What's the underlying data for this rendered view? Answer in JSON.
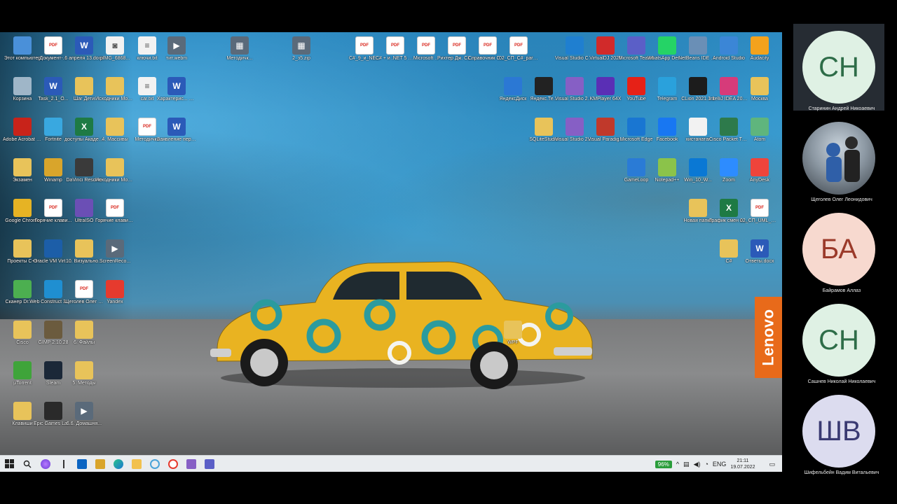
{
  "colors": {
    "pdf_red": "#d9261c",
    "word_blue": "#2b5ab8",
    "excel_green": "#1e7a44",
    "folder_yellow": "#e8c35a",
    "lenovo_orange": "#e86a1a",
    "battery_green": "#2a9d3b",
    "avatar_green_bg": "#dff1e4",
    "avatar_green_fg": "#2e6d48",
    "avatar_pink_bg": "#f7d9cf",
    "avatar_pink_fg": "#9b3a2a",
    "avatar_purple_bg": "#dcdcef",
    "avatar_purple_fg": "#3a3a72"
  },
  "wallpaper": {
    "brand": "Lenovo"
  },
  "desktop_icons": [
    {
      "label": "Этот компьютер",
      "icon": "computer-icon"
    },
    {
      "label": "Документ-...",
      "icon": "pdf-icon"
    },
    {
      "label": "6 апреля 13.docx",
      "icon": "word-icon"
    },
    {
      "label": "pIMG_6868...",
      "icon": "photo-icon"
    },
    {
      "label": "ключи.txt",
      "icon": "text-file-icon"
    },
    {
      "label": "тит.webm",
      "icon": "video-icon"
    },
    {
      "label": "Методичк...",
      "icon": "archive-icon"
    },
    {
      "label": "2_з5.zip",
      "icon": "archive-icon"
    },
    {
      "label": "C#_9_и_NE...",
      "icon": "pdf-icon"
    },
    {
      "label": "C# + и .NET 5 Разработ...",
      "icon": "pdf-icon"
    },
    {
      "label": "Microsoft ...",
      "icon": "pdf-icon"
    },
    {
      "label": "Рихтер Дж. CLR via C#...",
      "icon": "pdf-icon"
    },
    {
      "label": "Справочник C# Кудряв...",
      "icon": "pdf-icon"
    },
    {
      "label": "02_СП_C#_part1.pdf",
      "icon": "pdf-icon"
    },
    {
      "label": "Visual Studio Code",
      "icon": "vscode-icon"
    },
    {
      "label": "VirtualDJ 2021",
      "icon": "virtualdj-icon"
    },
    {
      "label": "Microsoft Teams",
      "icon": "teams-icon"
    },
    {
      "label": "WhatsApp Desktop",
      "icon": "whatsapp-icon"
    },
    {
      "label": "NetBeans IDE 8.2",
      "icon": "netbeans-icon"
    },
    {
      "label": "Android Studio",
      "icon": "android-studio-icon"
    },
    {
      "label": "Audacity",
      "icon": "audacity-icon"
    },
    {
      "label": "Корзина",
      "icon": "recycle-bin-icon"
    },
    {
      "label": "Task_2.1_O...",
      "icon": "word-icon"
    },
    {
      "label": "Шаг Дети",
      "icon": "folder-icon"
    },
    {
      "label": "Исходники Модуль 10",
      "icon": "folder-icon"
    },
    {
      "label": "car.txt",
      "icon": "text-file-icon"
    },
    {
      "label": "Характерис... Захаткин...",
      "icon": "word-icon"
    },
    {
      "label": "ЯндексДиск",
      "icon": "yandex-disk-icon"
    },
    {
      "label": "Яндекс.Те...",
      "icon": "yandex-telemost-icon"
    },
    {
      "label": "Visual Studio 2022",
      "icon": "visual-studio-icon"
    },
    {
      "label": "KMPlayer 64X",
      "icon": "kmplayer-icon"
    },
    {
      "label": "YouTube",
      "icon": "youtube-icon"
    },
    {
      "label": "Telegram",
      "icon": "telegram-icon"
    },
    {
      "label": "CLion 2021.1.1",
      "icon": "clion-icon"
    },
    {
      "label": "IntelliJ IDEA 2020.3 x64",
      "icon": "intellij-icon"
    },
    {
      "label": "Москва",
      "icon": "folder-icon"
    },
    {
      "label": "Adobe Acrobat DC",
      "icon": "acrobat-icon"
    },
    {
      "label": "Fortnite",
      "icon": "fortnite-icon"
    },
    {
      "label": "доступы Академия ...",
      "icon": "excel-icon"
    },
    {
      "label": "4. Массивы",
      "icon": "folder-icon"
    },
    {
      "label": "Методички",
      "icon": "pdf-icon"
    },
    {
      "label": "Заявление периодиче...",
      "icon": "word-icon"
    },
    {
      "label": "SQLiteStudio",
      "icon": "folder-icon"
    },
    {
      "label": "Visual Studio 2017",
      "icon": "visual-studio-icon"
    },
    {
      "label": "Visual Paradig...",
      "icon": "visual-paradigm-icon"
    },
    {
      "label": "Microsoft Edge",
      "icon": "edge-icon"
    },
    {
      "label": "Facebook",
      "icon": "facebook-icon"
    },
    {
      "label": "хистанатаг",
      "icon": "file-icon"
    },
    {
      "label": "Cisco Packet Tracer",
      "icon": "cisco-packet-tracer-icon"
    },
    {
      "label": "Atom",
      "icon": "atom-icon"
    },
    {
      "label": "Экзамен",
      "icon": "folder-icon"
    },
    {
      "label": "Winamp",
      "icon": "winamp-icon"
    },
    {
      "label": "DaVinci Resolve",
      "icon": "davinci-icon"
    },
    {
      "label": "Исходники Модуль 6",
      "icon": "folder-icon"
    },
    {
      "label": "GameLoop",
      "icon": "gameloop-icon"
    },
    {
      "label": "Notepad++",
      "icon": "notepadpp-icon"
    },
    {
      "label": "Win_10_W...",
      "icon": "windows-icon"
    },
    {
      "label": "Zoom",
      "icon": "zoom-icon"
    },
    {
      "label": "AnyDesk",
      "icon": "anydesk-icon"
    },
    {
      "label": "Google Chrome",
      "icon": "chrome-icon"
    },
    {
      "label": "Горячие клави...",
      "icon": "pdf-icon"
    },
    {
      "label": "UltraISO",
      "icon": "ultraiso-icon"
    },
    {
      "label": "Горячие клавиш...",
      "icon": "pdf-icon"
    },
    {
      "label": "Новая папка",
      "icon": "folder-icon"
    },
    {
      "label": "График смен 2022.xlsx",
      "icon": "excel-icon"
    },
    {
      "label": "02_СП_UML_ОР_4...",
      "icon": "pdf-icon"
    },
    {
      "label": "Проекты C++",
      "icon": "folder-icon"
    },
    {
      "label": "Oracle VM VirtualBox",
      "icon": "virtualbox-icon"
    },
    {
      "label": "10. Визуально...",
      "icon": "folder-icon"
    },
    {
      "label": "ScreenReco...",
      "icon": "video-icon"
    },
    {
      "label": "C#",
      "icon": "folder-icon"
    },
    {
      "label": "Ответы.docx",
      "icon": "word-icon"
    },
    {
      "label": "Сканер Dr.Web",
      "icon": "drweb-icon"
    },
    {
      "label": "Construct 3",
      "icon": "construct-icon"
    },
    {
      "label": "Щеголев Олег Леони...",
      "icon": "pdf-icon"
    },
    {
      "label": "Yandex",
      "icon": "yandex-browser-icon"
    },
    {
      "label": "Cisco",
      "icon": "folder-icon"
    },
    {
      "label": "GIMP 2.10.28",
      "icon": "gimp-icon"
    },
    {
      "label": "6. Файлы",
      "icon": "folder-icon"
    },
    {
      "label": "WPF",
      "icon": "folder-icon"
    },
    {
      "label": "µTorrent",
      "icon": "utorrent-icon"
    },
    {
      "label": "Steam",
      "icon": "steam-icon"
    },
    {
      "label": "5. Методы",
      "icon": "folder-icon"
    },
    {
      "label": "Клавиши",
      "icon": "folder-icon"
    },
    {
      "label": "Epic Games Launcher",
      "icon": "epic-games-icon"
    },
    {
      "label": "6.6. Домашня...",
      "icon": "video-icon"
    }
  ],
  "taskbar": {
    "items": [
      {
        "icon": "windows-start-icon"
      },
      {
        "icon": "search-icon"
      },
      {
        "icon": "alice-assistant-icon"
      },
      {
        "icon": "taskview-icon"
      },
      {
        "icon": "outlook-icon"
      },
      {
        "icon": "winamp-icon"
      },
      {
        "icon": "edge-icon"
      },
      {
        "icon": "file-explorer-icon"
      },
      {
        "icon": "refresh-icon"
      },
      {
        "icon": "yandex-browser-icon"
      },
      {
        "icon": "visual-studio-icon"
      },
      {
        "icon": "teams-icon"
      }
    ],
    "battery": "96%",
    "language": "ENG",
    "time": "21:11",
    "date": "19.07.2022"
  },
  "participants": [
    {
      "initials": "СН",
      "name": "Старинин Андрей Никоаевич",
      "style": "green",
      "active": true
    },
    {
      "initials": "",
      "name": "Щеголев Олег Леонидович",
      "style": "photo",
      "active": false
    },
    {
      "initials": "БА",
      "name": "Байрамов Аллаз",
      "style": "pink",
      "active": false
    },
    {
      "initials": "СН",
      "name": "Сашнев Николай Николаевич",
      "style": "green",
      "active": false
    },
    {
      "initials": "ШВ",
      "name": "Шифельбейн Вадим Витальевич",
      "style": "purple",
      "active": false
    }
  ]
}
